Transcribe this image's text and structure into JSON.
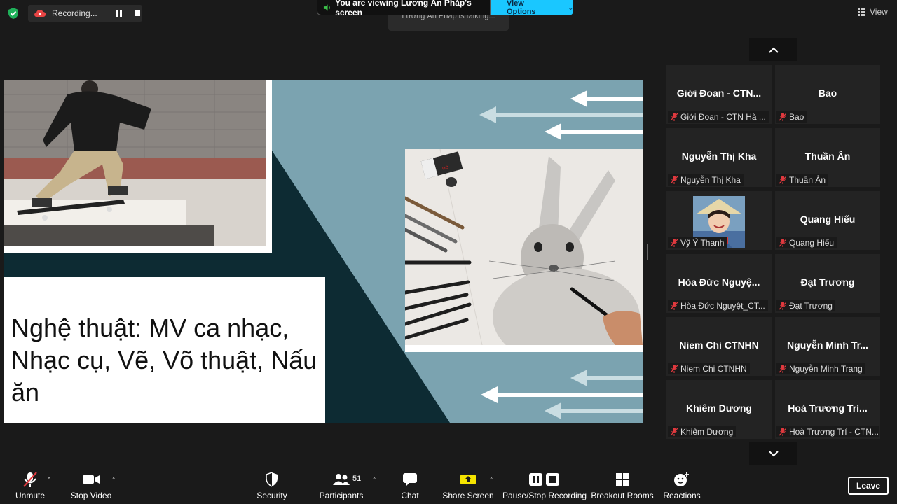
{
  "topbar": {
    "recording_label": "Recording...",
    "talking_label": "Lương Ân Pháp is talking...",
    "viewing_label": "You are viewing Lương Ân Pháp's screen",
    "view_options_label": "View Options",
    "view_label": "View"
  },
  "slide": {
    "title": "Nghệ thuật: MV ca nhạc, Nhạc cụ, Vẽ, Võ thuật, Nấu ăn",
    "eraser_text": "oo",
    "colors": {
      "background": "#7ba3b0",
      "dark_panel": "#0d2b33"
    }
  },
  "gallery": {
    "tiles": [
      {
        "name": "Giới Đoan - CTN...",
        "label": "Giới Đoan - CTN Hà ..."
      },
      {
        "name": "Bao",
        "label": "Bao"
      },
      {
        "name": "Nguyễn Thị Kha",
        "label": "Nguyễn Thị Kha"
      },
      {
        "name": "Thuần Ân",
        "label": "Thuần Ân"
      },
      {
        "name": "",
        "label": "Vỹ Ý Thanh"
      },
      {
        "name": "Quang Hiếu",
        "label": "Quang Hiếu"
      },
      {
        "name": "Hòa Đức Nguyệ...",
        "label": "Hòa Đức Nguyệt_CT..."
      },
      {
        "name": "Đạt Trương",
        "label": "Đạt Trương"
      },
      {
        "name": "Niem Chi CTNHN",
        "label": "Niem Chi CTNHN"
      },
      {
        "name": "Nguyễn Minh Tr...",
        "label": "Nguyễn Minh Trang"
      },
      {
        "name": "Khiêm Dương",
        "label": "Khiêm Dương"
      },
      {
        "name": "Hoà Trương Trí...",
        "label": "Hoà Trương Trí - CTN..."
      }
    ]
  },
  "toolbar": {
    "unmute": "Unmute",
    "stop_video": "Stop Video",
    "security": "Security",
    "participants": "Participants",
    "participant_count": "51",
    "chat": "Chat",
    "share_screen": "Share Screen",
    "pause_stop_recording": "Pause/Stop Recording",
    "breakout_rooms": "Breakout Rooms",
    "reactions": "Reactions",
    "leave": "Leave"
  },
  "colors": {
    "accent": "#1ac7ff",
    "share_green": "#f5e400",
    "mute_red": "#e0393e",
    "security_green": "#22c55e"
  }
}
